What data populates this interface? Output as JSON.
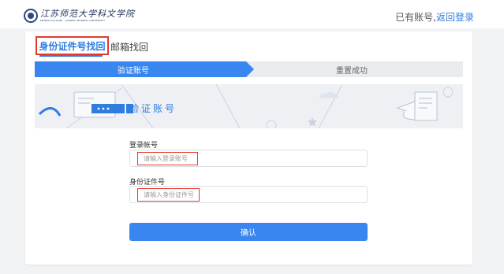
{
  "header": {
    "logo_cn": "江苏师范大学科文学院",
    "logo_en": "KEWEN COLLEGE · JIANGSU NORMAL UNIVERSITY",
    "account_prompt": "已有账号,",
    "login_link": "返回登录"
  },
  "tabs": [
    {
      "label": "身份证件号找回",
      "active": true
    },
    {
      "label": "邮箱找回",
      "active": false
    }
  ],
  "steps": [
    {
      "label": "验证账号",
      "active": true
    },
    {
      "label": "重置成功",
      "active": false
    }
  ],
  "banner": {
    "title": "验证账号",
    "illustration_icons": [
      "monitor-icon",
      "password-dialog-icon",
      "document-icon",
      "graduation-cap-icon",
      "star-icon",
      "cloud-icon"
    ]
  },
  "form": {
    "account_label": "登录帐号",
    "account_placeholder": "请输入登录账号",
    "id_label": "身份证件号",
    "id_placeholder": "请输入身份证件号",
    "confirm_label": "确认"
  },
  "colors": {
    "accent": "#2f7de1",
    "button": "#3a86f0",
    "highlight_border": "#e23a2c",
    "page_background": "#f2f3f5"
  }
}
